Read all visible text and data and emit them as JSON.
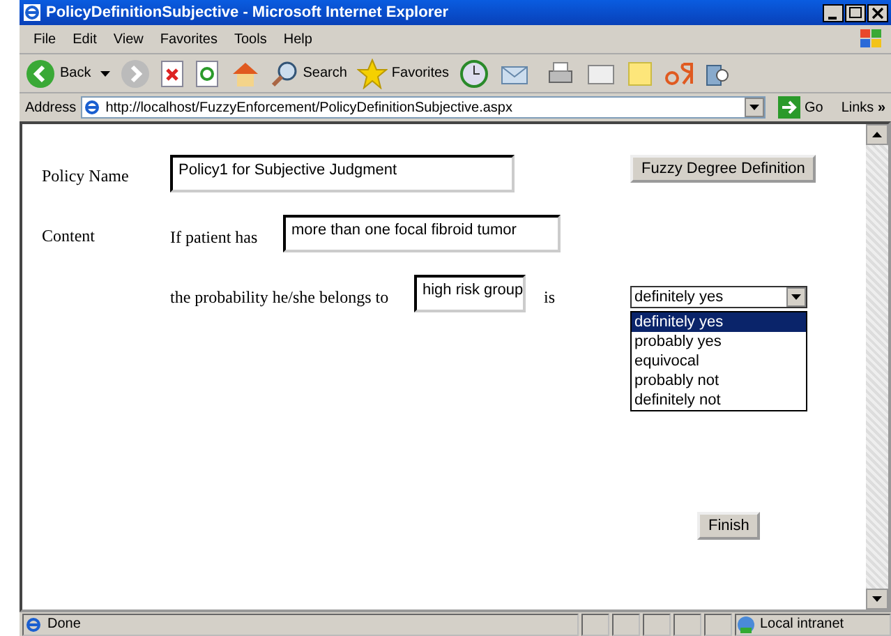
{
  "window": {
    "title": "PolicyDefinitionSubjective - Microsoft Internet Explorer"
  },
  "menu": [
    "File",
    "Edit",
    "View",
    "Favorites",
    "Tools",
    "Help"
  ],
  "toolbar": {
    "back": "Back",
    "search": "Search",
    "favorites": "Favorites"
  },
  "address_bar": {
    "label": "Address",
    "url": "http://localhost/FuzzyEnforcement/PolicyDefinitionSubjective.aspx",
    "go": "Go",
    "links": "Links",
    "more": "»"
  },
  "form": {
    "policy_name_label": "Policy Name",
    "policy_name": "Policy1 for Subjective Judgment",
    "fuzzy_button": "Fuzzy Degree Definition",
    "content_label": "Content",
    "if_label": "If patient has",
    "condition": "more than one focal fibroid tumor",
    "probability_label": "the probability he/she belongs to",
    "group": "high risk group",
    "is_label": "is",
    "degree": {
      "value": "definitely yes",
      "expanded": true,
      "options": [
        {
          "label": "definitely yes",
          "selected": true
        },
        {
          "label": "probably yes",
          "selected": false
        },
        {
          "label": "equivocal",
          "selected": false
        },
        {
          "label": "probably not",
          "selected": false
        },
        {
          "label": "definitely not",
          "selected": false
        }
      ]
    },
    "finish_button": "Finish"
  },
  "status_bar": {
    "text": "Done",
    "zone": "Local intranet"
  }
}
